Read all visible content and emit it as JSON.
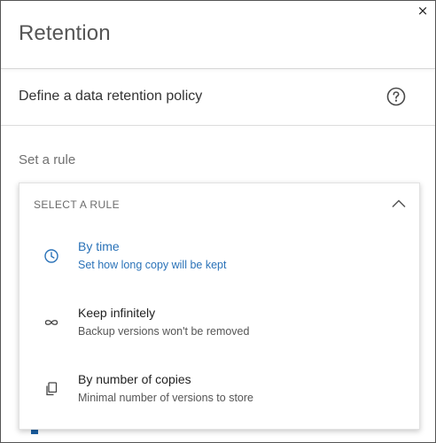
{
  "dialog": {
    "title": "Retention",
    "close_glyph": "×",
    "close_icon": "close-icon"
  },
  "section": {
    "title": "Define a data retention policy",
    "help_icon": "help-circle-icon"
  },
  "rule_field": {
    "label": "Set a rule",
    "dropdown": {
      "header_label": "SELECT A RULE",
      "expanded": true,
      "chevron_icon": "chevron-up-icon",
      "options": [
        {
          "title": "By time",
          "description": "Set how long copy will be kept",
          "icon": "clock-icon",
          "highlighted": true
        },
        {
          "title": "Keep infinitely",
          "description": "Backup versions won't be removed",
          "icon": "infinity-icon",
          "highlighted": false
        },
        {
          "title": "By number of copies",
          "description": "Minimal number of versions to store",
          "icon": "copies-icon",
          "highlighted": false
        }
      ]
    }
  },
  "colors": {
    "accent": "#2a72b8",
    "title_text": "#555555",
    "label_text": "#707070",
    "border": "#555555"
  }
}
